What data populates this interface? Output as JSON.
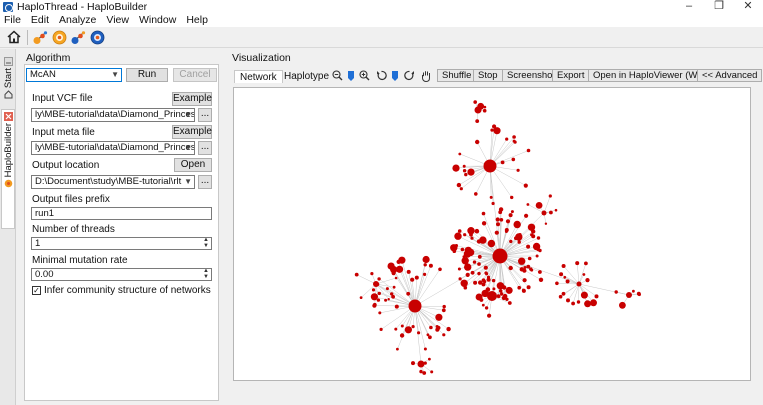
{
  "window": {
    "title": "HaploThread - HaploBuilder",
    "minimize_glyph": "–",
    "maximize_glyph": "❐",
    "close_glyph": "✕"
  },
  "menu": [
    "File",
    "Edit",
    "Analyze",
    "View",
    "Window",
    "Help"
  ],
  "toolbar": {
    "icons": [
      "home-icon",
      "orange-molecule-icon",
      "orange-circle-icon",
      "blue-molecule-icon",
      "blue-circle-icon"
    ]
  },
  "side_tabs": {
    "start": "Start",
    "haplobuilder": "HaploBuilder"
  },
  "algorithm": {
    "panel_title": "Algorithm",
    "method_selected": "McAN",
    "run_label": "Run",
    "cancel_label": "Cancel",
    "vcf_label": "Input VCF file",
    "vcf_value": "ly\\MBE-tutorial\\data\\Diamond_Princess.vcf",
    "meta_label": "Input meta file",
    "meta_value": "ly\\MBE-tutorial\\data\\Diamond_Princess.tsv",
    "example_label": "Example",
    "browse_label": "...",
    "output_label": "Output location",
    "output_value": "D:\\Document\\study\\MBE-tutorial\\rlt",
    "open_label": "Open",
    "prefix_label": "Output files prefix",
    "prefix_value": "run1",
    "threads_label": "Number of threads",
    "threads_value": "1",
    "mutation_label": "Minimal mutation rate",
    "mutation_value": "0.00",
    "community_label": "Infer community structure of networks",
    "community_checked": true,
    "check_glyph": "✓"
  },
  "visualization": {
    "panel_title": "Visualization",
    "tabs": [
      "Network",
      "Haplotype"
    ],
    "buttons": {
      "shuffle": "Shuffle",
      "stop": "Stop",
      "screenshot": "Screenshot",
      "export": "Export",
      "open_viewer": "Open in HaploViewer (Web)",
      "advanced": "<< Advanced"
    },
    "node_color": "#c80000",
    "edge_color": "#c8c8c8"
  }
}
